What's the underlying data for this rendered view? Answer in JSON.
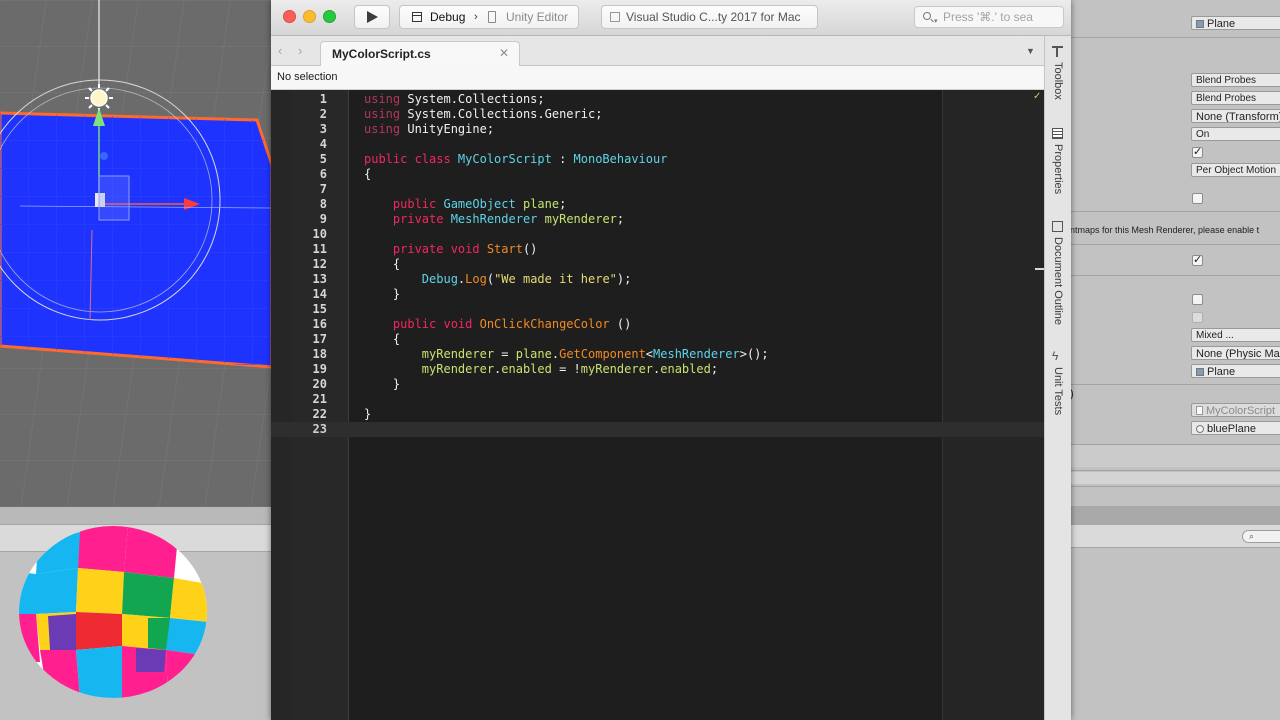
{
  "vs_window": {
    "run_button": "run",
    "configuration": "Debug",
    "run_target": "Unity Editor",
    "status_text": "Visual Studio C...ty 2017 for Mac",
    "search_placeholder": "Press '⌘.' to sea"
  },
  "tabs": [
    {
      "label": "MyColorScript.cs",
      "close": "✕"
    }
  ],
  "nav": {
    "back": "‹",
    "forward": "›",
    "tab_menu": "▼"
  },
  "selection_bar": "No selection",
  "editor": {
    "current_line": 23,
    "lines": [
      {
        "n": "1",
        "tokens": [
          [
            "kw-dim",
            "using"
          ],
          [
            "pl",
            " System.Collections;"
          ]
        ]
      },
      {
        "n": "2",
        "tokens": [
          [
            "kw-dim",
            "using"
          ],
          [
            "pl",
            " System.Collections.Generic;"
          ]
        ]
      },
      {
        "n": "3",
        "tokens": [
          [
            "kw-dim",
            "using"
          ],
          [
            "pl",
            " UnityEngine;"
          ]
        ]
      },
      {
        "n": "4",
        "tokens": []
      },
      {
        "n": "5",
        "tokens": [
          [
            "kw",
            "public class "
          ],
          [
            "ty",
            "MyColorScript"
          ],
          [
            "pl",
            " : "
          ],
          [
            "ty",
            "MonoBehaviour"
          ]
        ]
      },
      {
        "n": "6",
        "tokens": [
          [
            "pl",
            "{"
          ]
        ]
      },
      {
        "n": "7",
        "tokens": []
      },
      {
        "n": "8",
        "tokens": [
          [
            "pl",
            "    "
          ],
          [
            "kw",
            "public "
          ],
          [
            "ty",
            "GameObject"
          ],
          [
            "pl",
            " "
          ],
          [
            "id",
            "plane"
          ],
          [
            "pl",
            ";"
          ]
        ]
      },
      {
        "n": "9",
        "tokens": [
          [
            "pl",
            "    "
          ],
          [
            "kw",
            "private "
          ],
          [
            "ty",
            "MeshRenderer"
          ],
          [
            "pl",
            " "
          ],
          [
            "id",
            "myRenderer"
          ],
          [
            "pl",
            ";"
          ]
        ]
      },
      {
        "n": "10",
        "tokens": []
      },
      {
        "n": "11",
        "tokens": [
          [
            "pl",
            "    "
          ],
          [
            "kw",
            "private void "
          ],
          [
            "fn",
            "Start"
          ],
          [
            "pl",
            "()"
          ]
        ]
      },
      {
        "n": "12",
        "tokens": [
          [
            "pl",
            "    {"
          ]
        ]
      },
      {
        "n": "13",
        "tokens": [
          [
            "pl",
            "        "
          ],
          [
            "ty",
            "Debug"
          ],
          [
            "pl",
            "."
          ],
          [
            "fn",
            "Log"
          ],
          [
            "pl",
            "("
          ],
          [
            "st",
            "\"We made it here\""
          ],
          [
            "pl",
            ");"
          ]
        ]
      },
      {
        "n": "14",
        "tokens": [
          [
            "pl",
            "    }"
          ]
        ]
      },
      {
        "n": "15",
        "tokens": []
      },
      {
        "n": "16",
        "tokens": [
          [
            "pl",
            "    "
          ],
          [
            "kw",
            "public void "
          ],
          [
            "fn",
            "OnClickChangeColor"
          ],
          [
            "pl",
            " ()"
          ]
        ]
      },
      {
        "n": "17",
        "tokens": [
          [
            "pl",
            "    {"
          ]
        ]
      },
      {
        "n": "18",
        "tokens": [
          [
            "pl",
            "        "
          ],
          [
            "id",
            "myRenderer"
          ],
          [
            "pl",
            " = "
          ],
          [
            "id",
            "plane"
          ],
          [
            "pl",
            "."
          ],
          [
            "fn",
            "GetComponent"
          ],
          [
            "pl",
            "<"
          ],
          [
            "ty",
            "MeshRenderer"
          ],
          [
            "pl",
            ">();"
          ]
        ]
      },
      {
        "n": "19",
        "tokens": [
          [
            "pl",
            "        "
          ],
          [
            "id",
            "myRenderer"
          ],
          [
            "pl",
            "."
          ],
          [
            "id",
            "enabled"
          ],
          [
            "pl",
            " = !"
          ],
          [
            "id",
            "myRenderer"
          ],
          [
            "pl",
            "."
          ],
          [
            "id",
            "enabled"
          ],
          [
            "pl",
            ";"
          ]
        ]
      },
      {
        "n": "20",
        "tokens": [
          [
            "pl",
            "    }"
          ]
        ]
      },
      {
        "n": "21",
        "tokens": []
      },
      {
        "n": "22",
        "tokens": [
          [
            "pl",
            "}"
          ]
        ]
      },
      {
        "n": "23",
        "tokens": []
      }
    ]
  },
  "dock_pads": {
    "toolbox": "Toolbox",
    "properties": "Properties",
    "document_outline": "Document Outline",
    "unit_tests": "Unit Tests"
  },
  "inspector": {
    "material_field": "Plane",
    "light_probes": "Blend Probes",
    "reflection_probes": "Blend Probes",
    "anchor_override": "None (Transform)",
    "cast_shadows": "On",
    "receive_shadows_checked": "✓",
    "motion_vectors": "Per Object Motion",
    "lightmap_note": "ntmaps for this Mesh Renderer, please enable t",
    "collider_checked": "✓",
    "mixed_field": "Mixed ...",
    "physic_material": "None (Physic Ma",
    "mesh_field": "Plane",
    "paren_text": ")",
    "script_field": "MyColorScript",
    "object_field": "bluePlane",
    "search_glyph": "⌕"
  },
  "colors": {
    "plane_blue": "#1f33ff",
    "plane_outline": "#ff6a2b",
    "logo_colors": [
      "#ff1f8e",
      "#16b7f0",
      "#ffd21a",
      "#13a651",
      "#6a3bb5",
      "#ee2a32"
    ]
  }
}
